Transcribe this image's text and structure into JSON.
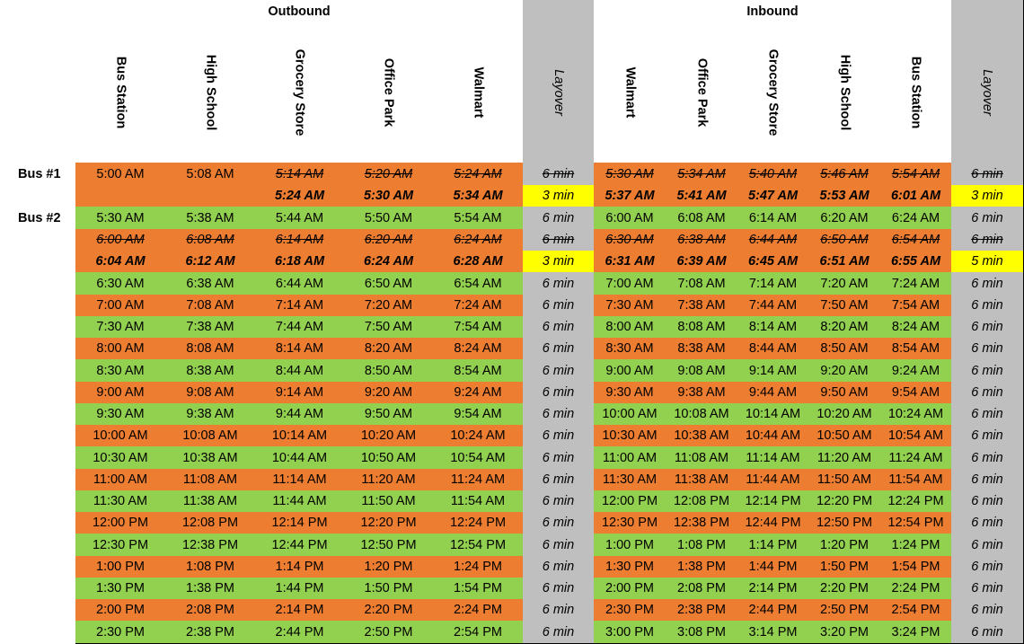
{
  "groups": {
    "outbound": "Outbound",
    "inbound": "Inbound"
  },
  "columns": [
    "Bus Station",
    "High School",
    "Grocery Store",
    "Office Park",
    "Walmart",
    "Layover",
    "Walmart",
    "Office Park",
    "Grocery Store",
    "High School",
    "Bus Station",
    "Layover"
  ],
  "bus_labels": {
    "bus1": "Bus #1",
    "bus2": "Bus #2"
  },
  "colors": {
    "green": "#92d050",
    "orange": "#ed7d31",
    "gray": "#bfbfbf",
    "yellow": "#ffff00"
  },
  "rows": [
    {
      "label": "Bus #1",
      "color": "orange",
      "cells": [
        "5:00 AM",
        "5:08 AM",
        "5:14 AM",
        "5:20 AM",
        "5:24 AM",
        "6 min",
        "5:30 AM",
        "5:34 AM",
        "5:40 AM",
        "5:46 AM",
        "5:54 AM",
        "6 min"
      ],
      "styles": [
        "",
        "",
        "s",
        "s",
        "s",
        "ls",
        "s",
        "s",
        "s",
        "s",
        "s",
        "ls"
      ]
    },
    {
      "label": "",
      "color": "orange",
      "cells": [
        "",
        "",
        "5:24 AM",
        "5:30 AM",
        "5:34 AM",
        "3 min",
        "5:37 AM",
        "5:41 AM",
        "5:47 AM",
        "5:53 AM",
        "6:01 AM",
        "3 min"
      ],
      "styles": [
        "",
        "",
        "b",
        "b",
        "b",
        "ly",
        "b",
        "b",
        "b",
        "b",
        "b",
        "ly"
      ]
    },
    {
      "label": "Bus #2",
      "color": "green",
      "cells": [
        "5:30 AM",
        "5:38 AM",
        "5:44 AM",
        "5:50 AM",
        "5:54 AM",
        "6 min",
        "6:00 AM",
        "6:08 AM",
        "6:14 AM",
        "6:20 AM",
        "6:24 AM",
        "6 min"
      ],
      "styles": []
    },
    {
      "label": "",
      "color": "orange",
      "cells": [
        "6:00 AM",
        "6:08 AM",
        "6:14 AM",
        "6:20 AM",
        "6:24 AM",
        "6 min",
        "6:30 AM",
        "6:38 AM",
        "6:44 AM",
        "6:50 AM",
        "6:54 AM",
        "6 min"
      ],
      "styles": [
        "s",
        "s",
        "s",
        "s",
        "s",
        "ls",
        "s",
        "s",
        "s",
        "s",
        "s",
        "ls"
      ]
    },
    {
      "label": "",
      "color": "orange",
      "cells": [
        "6:04 AM",
        "6:12 AM",
        "6:18 AM",
        "6:24 AM",
        "6:28 AM",
        "3 min",
        "6:31 AM",
        "6:39 AM",
        "6:45 AM",
        "6:51 AM",
        "6:55 AM",
        "5 min"
      ],
      "styles": [
        "b",
        "b",
        "b",
        "b",
        "b",
        "ly",
        "b",
        "b",
        "b",
        "b",
        "b",
        "ly"
      ]
    },
    {
      "label": "",
      "color": "green",
      "cells": [
        "6:30 AM",
        "6:38 AM",
        "6:44 AM",
        "6:50 AM",
        "6:54 AM",
        "6 min",
        "7:00 AM",
        "7:08 AM",
        "7:14 AM",
        "7:20 AM",
        "7:24 AM",
        "6 min"
      ],
      "styles": []
    },
    {
      "label": "",
      "color": "orange",
      "cells": [
        "7:00 AM",
        "7:08 AM",
        "7:14 AM",
        "7:20 AM",
        "7:24 AM",
        "6 min",
        "7:30 AM",
        "7:38 AM",
        "7:44 AM",
        "7:50 AM",
        "7:54 AM",
        "6 min"
      ],
      "styles": []
    },
    {
      "label": "",
      "color": "green",
      "cells": [
        "7:30 AM",
        "7:38 AM",
        "7:44 AM",
        "7:50 AM",
        "7:54 AM",
        "6 min",
        "8:00 AM",
        "8:08 AM",
        "8:14 AM",
        "8:20 AM",
        "8:24 AM",
        "6 min"
      ],
      "styles": []
    },
    {
      "label": "",
      "color": "orange",
      "cells": [
        "8:00 AM",
        "8:08 AM",
        "8:14 AM",
        "8:20 AM",
        "8:24 AM",
        "6 min",
        "8:30 AM",
        "8:38 AM",
        "8:44 AM",
        "8:50 AM",
        "8:54 AM",
        "6 min"
      ],
      "styles": []
    },
    {
      "label": "",
      "color": "green",
      "cells": [
        "8:30 AM",
        "8:38 AM",
        "8:44 AM",
        "8:50 AM",
        "8:54 AM",
        "6 min",
        "9:00 AM",
        "9:08 AM",
        "9:14 AM",
        "9:20 AM",
        "9:24 AM",
        "6 min"
      ],
      "styles": []
    },
    {
      "label": "",
      "color": "orange",
      "cells": [
        "9:00 AM",
        "9:08 AM",
        "9:14 AM",
        "9:20 AM",
        "9:24 AM",
        "6 min",
        "9:30 AM",
        "9:38 AM",
        "9:44 AM",
        "9:50 AM",
        "9:54 AM",
        "6 min"
      ],
      "styles": []
    },
    {
      "label": "",
      "color": "green",
      "cells": [
        "9:30 AM",
        "9:38 AM",
        "9:44 AM",
        "9:50 AM",
        "9:54 AM",
        "6 min",
        "10:00 AM",
        "10:08 AM",
        "10:14 AM",
        "10:20 AM",
        "10:24 AM",
        "6 min"
      ],
      "styles": []
    },
    {
      "label": "",
      "color": "orange",
      "cells": [
        "10:00 AM",
        "10:08 AM",
        "10:14 AM",
        "10:20 AM",
        "10:24 AM",
        "6 min",
        "10:30 AM",
        "10:38 AM",
        "10:44 AM",
        "10:50 AM",
        "10:54 AM",
        "6 min"
      ],
      "styles": []
    },
    {
      "label": "",
      "color": "green",
      "cells": [
        "10:30 AM",
        "10:38 AM",
        "10:44 AM",
        "10:50 AM",
        "10:54 AM",
        "6 min",
        "11:00 AM",
        "11:08 AM",
        "11:14 AM",
        "11:20 AM",
        "11:24 AM",
        "6 min"
      ],
      "styles": []
    },
    {
      "label": "",
      "color": "orange",
      "cells": [
        "11:00 AM",
        "11:08 AM",
        "11:14 AM",
        "11:20 AM",
        "11:24 AM",
        "6 min",
        "11:30 AM",
        "11:38 AM",
        "11:44 AM",
        "11:50 AM",
        "11:54 AM",
        "6 min"
      ],
      "styles": []
    },
    {
      "label": "",
      "color": "green",
      "cells": [
        "11:30 AM",
        "11:38 AM",
        "11:44 AM",
        "11:50 AM",
        "11:54 AM",
        "6 min",
        "12:00 PM",
        "12:08 PM",
        "12:14 PM",
        "12:20 PM",
        "12:24 PM",
        "6 min"
      ],
      "styles": []
    },
    {
      "label": "",
      "color": "orange",
      "cells": [
        "12:00 PM",
        "12:08 PM",
        "12:14 PM",
        "12:20 PM",
        "12:24 PM",
        "6 min",
        "12:30 PM",
        "12:38 PM",
        "12:44 PM",
        "12:50 PM",
        "12:54 PM",
        "6 min"
      ],
      "styles": []
    },
    {
      "label": "",
      "color": "green",
      "cells": [
        "12:30 PM",
        "12:38 PM",
        "12:44 PM",
        "12:50 PM",
        "12:54 PM",
        "6 min",
        "1:00 PM",
        "1:08 PM",
        "1:14 PM",
        "1:20 PM",
        "1:24 PM",
        "6 min"
      ],
      "styles": []
    },
    {
      "label": "",
      "color": "orange",
      "cells": [
        "1:00 PM",
        "1:08 PM",
        "1:14 PM",
        "1:20 PM",
        "1:24 PM",
        "6 min",
        "1:30 PM",
        "1:38 PM",
        "1:44 PM",
        "1:50 PM",
        "1:54 PM",
        "6 min"
      ],
      "styles": []
    },
    {
      "label": "",
      "color": "green",
      "cells": [
        "1:30 PM",
        "1:38 PM",
        "1:44 PM",
        "1:50 PM",
        "1:54 PM",
        "6 min",
        "2:00 PM",
        "2:08 PM",
        "2:14 PM",
        "2:20 PM",
        "2:24 PM",
        "6 min"
      ],
      "styles": []
    },
    {
      "label": "",
      "color": "orange",
      "cells": [
        "2:00 PM",
        "2:08 PM",
        "2:14 PM",
        "2:20 PM",
        "2:24 PM",
        "6 min",
        "2:30 PM",
        "2:38 PM",
        "2:44 PM",
        "2:50 PM",
        "2:54 PM",
        "6 min"
      ],
      "styles": []
    },
    {
      "label": "",
      "color": "green",
      "cells": [
        "2:30 PM",
        "2:38 PM",
        "2:44 PM",
        "2:50 PM",
        "2:54 PM",
        "6 min",
        "3:00 PM",
        "3:08 PM",
        "3:14 PM",
        "3:20 PM",
        "3:24 PM",
        "6 min"
      ],
      "styles": []
    }
  ]
}
